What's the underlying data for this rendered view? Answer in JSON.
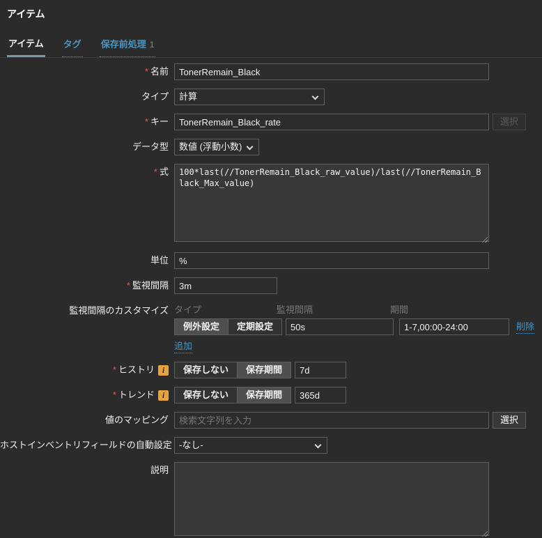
{
  "page": {
    "title": "アイテム"
  },
  "tabs": {
    "item": "アイテム",
    "tags": "タグ",
    "preprocessing": "保存前処理",
    "preprocessing_count": "1"
  },
  "colors": {
    "background": "#2b2b2b",
    "link_blue": "#4796c4",
    "required_red": "#e45959",
    "info_icon_orange": "#e8a33d",
    "active_tab_underline": "#7c98a5",
    "selected_segment": "#4f4f4f",
    "textarea_bg": "#383838"
  },
  "form": {
    "name": {
      "label": "名前",
      "value": "TonerRemain_Black"
    },
    "type": {
      "label": "タイプ",
      "value": "計算"
    },
    "key": {
      "label": "キー",
      "value": "TonerRemain_Black_rate",
      "select_button": "選択"
    },
    "data_type": {
      "label": "データ型",
      "value": "数値 (浮動小数)"
    },
    "formula": {
      "label": "式",
      "value": "100*last(//TonerRemain_Black_raw_value)/last(//TonerRemain_Black_Max_value)"
    },
    "units": {
      "label": "単位",
      "value": "%"
    },
    "update_interval": {
      "label": "監視間隔",
      "value": "3m"
    },
    "custom_intervals": {
      "label": "監視間隔のカスタマイズ",
      "columns": {
        "type": "タイプ",
        "interval": "監視間隔",
        "period": "期間"
      },
      "row": {
        "type_flexible": "例外設定",
        "type_scheduling": "定期設定",
        "selected_type": "例外設定",
        "interval": "50s",
        "period": "1-7,00:00-24:00",
        "remove_label": "削除"
      },
      "add_label": "追加"
    },
    "history": {
      "label": "ヒストリ",
      "option_no_keep": "保存しない",
      "option_keep": "保存期間",
      "selected": "保存期間",
      "value": "7d",
      "info_icon": "i"
    },
    "trends": {
      "label": "トレンド",
      "option_no_keep": "保存しない",
      "option_keep": "保存期間",
      "selected": "保存期間",
      "value": "365d",
      "info_icon": "i"
    },
    "value_mapping": {
      "label": "値のマッピング",
      "placeholder": "検索文字列を入力",
      "select_button": "選択"
    },
    "host_inventory": {
      "label": "ホストインベントリフィールドの自動設定",
      "value": "-なし-"
    },
    "description": {
      "label": "説明",
      "value": ""
    }
  }
}
